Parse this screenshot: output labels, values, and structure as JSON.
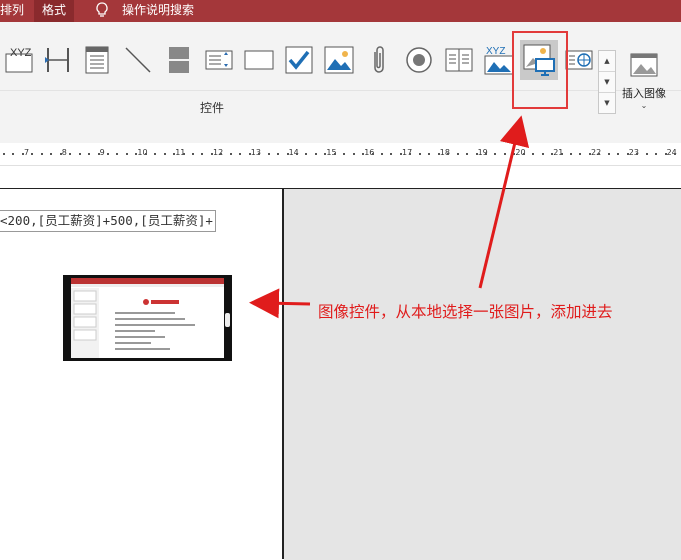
{
  "menubar": {
    "tabs": [
      {
        "label": "排列"
      },
      {
        "label": "格式"
      },
      {
        "label": "操作说明搜索"
      }
    ]
  },
  "ribbon": {
    "group_label": "控件",
    "insert_image_label": "插入图像",
    "xyz_label": "XYZ",
    "controls": [
      "text-box-icon",
      "splitter-icon",
      "list-box-icon",
      "line-icon",
      "split-bar-icon",
      "combo-box-icon",
      "rectangle-icon",
      "check-box-icon",
      "image-icon",
      "attachment-icon",
      "option-button-icon",
      "tab-control-icon",
      "chart-icon",
      "image-control-icon",
      "web-browser-icon"
    ]
  },
  "ruler": {
    "numbers": [
      "7",
      "8",
      "9",
      "10",
      "11",
      "12",
      "13",
      "14",
      "15",
      "16",
      "17",
      "18",
      "19",
      "20",
      "21",
      "22",
      "23",
      "24"
    ]
  },
  "document": {
    "formula_text": "<200,[员工薪资]+500,[员工薪资]+"
  },
  "annotation": {
    "text": "图像控件，从本地选择一张图片，添加进去",
    "color": "#e01c1c"
  },
  "colors": {
    "menubar": "#a4373a",
    "accent": "#a4373a",
    "highlight": "#e23a3a"
  }
}
